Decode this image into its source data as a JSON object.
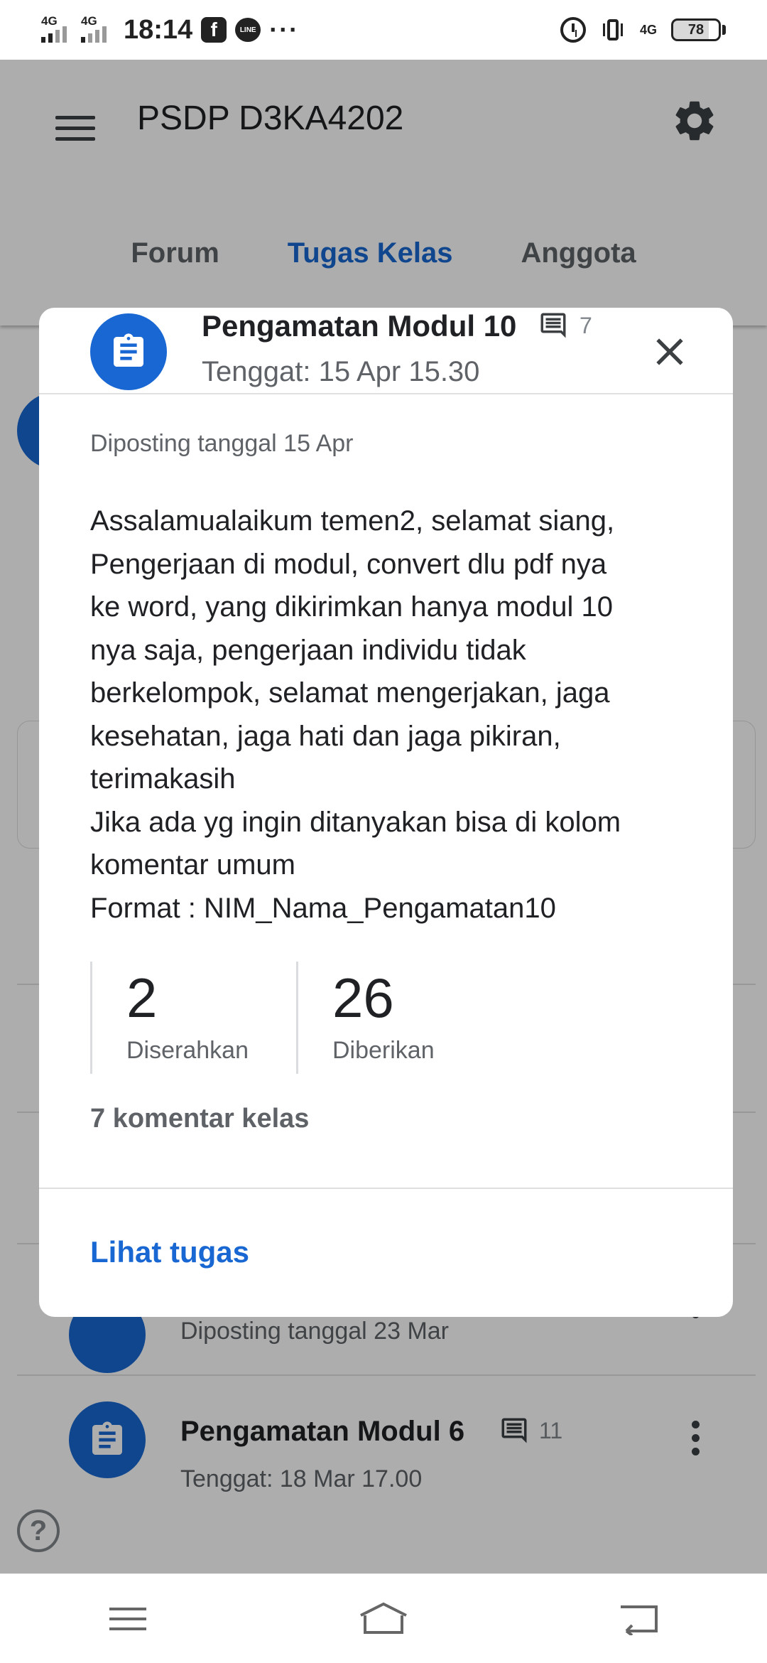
{
  "status_bar": {
    "sim1_label": "4G",
    "sim2_label": "4G",
    "time": "18:14",
    "fb_label": "f",
    "line_label": "LINE",
    "more": "···",
    "net_label": "4G",
    "battery": "78"
  },
  "header": {
    "class_title": "PSDP D3KA4202",
    "tabs": [
      {
        "label": "Forum"
      },
      {
        "label": "Tugas Kelas"
      },
      {
        "label": "Anggota"
      }
    ]
  },
  "background_list": {
    "partial_posted": "Diposting tanggal 23 Mar",
    "item": {
      "title": "Pengamatan Modul 6",
      "comments": "11",
      "due": "Tenggat: 18 Mar 17.00"
    },
    "help": "?"
  },
  "dialog": {
    "title": "Pengamatan Modul 10",
    "comment_count": "7",
    "due": "Tenggat: 15 Apr 15.30",
    "posted": "Diposting tanggal 15 Apr",
    "description_lines": [
      "Assalamualaikum temen2, selamat siang,",
      "Pengerjaan di modul, convert dlu pdf nya",
      "ke word, yang dikirimkan hanya modul 10",
      "nya saja, pengerjaan individu tidak",
      "berkelompok, selamat mengerjakan, jaga",
      "kesehatan, jaga hati dan jaga pikiran,",
      "terimakasih",
      "Jika ada yg ingin ditanyakan bisa di kolom",
      "komentar umum",
      "Format : NIM_Nama_Pengamatan10"
    ],
    "stats": [
      {
        "value": "2",
        "label": "Diserahkan"
      },
      {
        "value": "26",
        "label": "Diberikan"
      }
    ],
    "class_comments": "7 komentar kelas",
    "view_link": "Lihat tugas"
  },
  "colors": {
    "accent": "#1967d2",
    "scrim": "rgba(0,0,0,0.32)"
  }
}
